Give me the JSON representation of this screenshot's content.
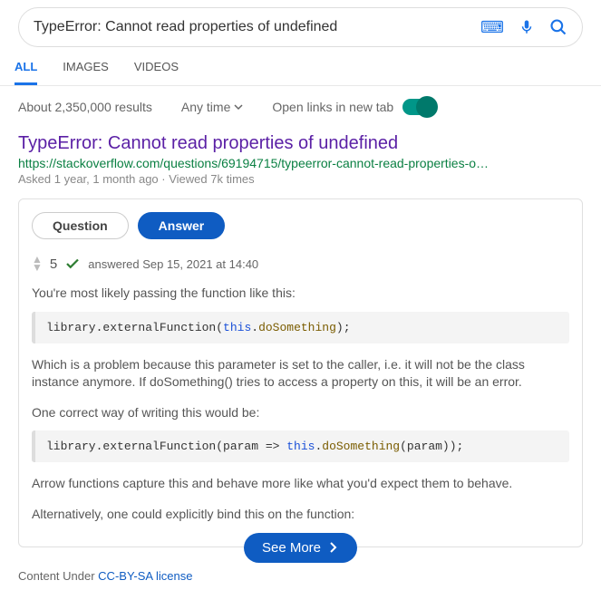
{
  "search": {
    "query": "TypeError: Cannot read properties of undefined"
  },
  "tabs": {
    "all": "ALL",
    "images": "IMAGES",
    "videos": "VIDEOS"
  },
  "meta": {
    "results": "About 2,350,000 results",
    "anytime": "Any time",
    "openlinks": "Open links in new tab"
  },
  "result": {
    "title": "TypeError: Cannot read properties of undefined",
    "url": "https://stackoverflow.com/questions/69194715/typeerror-cannot-read-properties-o…",
    "asked": "Asked 1 year, 1 month ago · Viewed 7k times"
  },
  "pills": {
    "question": "Question",
    "answer": "Answer"
  },
  "vote": {
    "count": "5",
    "answered": "answered Sep 15, 2021 at 14:40"
  },
  "body": {
    "p1": "You're most likely passing the function like this:",
    "code1_pre": "library.externalFunction(",
    "code1_this": "this",
    "code1_dot": ".",
    "code1_method": "doSomething",
    "code1_post": ");",
    "p2": "Which is a problem because this parameter is set to the caller, i.e. it will not be the class instance anymore. If doSomething() tries to access a property on this, it will be an error.",
    "p3": "One correct way of writing this would be:",
    "code2_pre": "library.externalFunction(param => ",
    "code2_this": "this",
    "code2_dot": ".",
    "code2_method": "doSomething",
    "code2_post": "(param));",
    "p4": "Arrow functions capture this and behave more like what you'd expect them to behave.",
    "p5": "Alternatively, one could explicitly bind this on the function:"
  },
  "seemore": "See More",
  "license": {
    "prefix": "Content Under ",
    "link": "CC-BY-SA license"
  }
}
